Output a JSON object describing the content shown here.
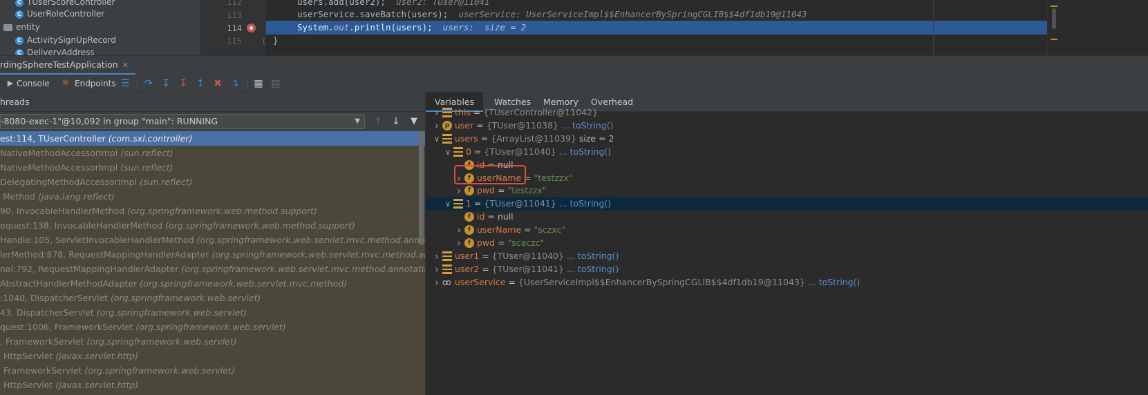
{
  "project_tree": [
    {
      "kind": "class",
      "label": "TUserScoreController"
    },
    {
      "kind": "class",
      "label": "UserRoleController"
    },
    {
      "kind": "folder",
      "label": "entity"
    },
    {
      "kind": "class",
      "label": "ActivitySignUpRecord"
    },
    {
      "kind": "class",
      "label": "DeliveryAddress"
    }
  ],
  "editor": {
    "lines": [
      {
        "no": "112",
        "code": "users.add(user2);",
        "hint": "user2: TUser@11041"
      },
      {
        "no": "113",
        "code": "userService.saveBatch(users);",
        "hint": "userService: UserServiceImpl$$EnhancerBySpringCGLIB$$4df1db19@11043"
      },
      {
        "no": "114",
        "code": "System.out.println(users);",
        "hint": "users:  size = 2"
      },
      {
        "no": "115",
        "code": "}",
        "hint": ""
      }
    ]
  },
  "debug": {
    "session_tab": "rdingSphereTestApplication",
    "toolbar": {
      "console": "Console",
      "endpoints": "Endpoints"
    },
    "frames_header": "hreads",
    "thread": "-8080-exec-1\"@10,092 in group \"main\": RUNNING",
    "frames": [
      {
        "method": "est:114, TUserController",
        "pkg": "(com.sxl.controller)"
      },
      {
        "method": "NativeMethodAccessorImpl",
        "pkg": "(sun.reflect)"
      },
      {
        "method": "NativeMethodAccessorImpl",
        "pkg": "(sun.reflect)"
      },
      {
        "method": "DelegatingMethodAccessorImpl",
        "pkg": "(sun.reflect)"
      },
      {
        "method": "Method",
        "pkg": "(java.lang.reflect)"
      },
      {
        "method": "90, InvocableHandlerMethod",
        "pkg": "(org.springframework.web.method.support)"
      },
      {
        "method": "equest:138, InvocableHandlerMethod",
        "pkg": "(org.springframework.web.method.support)"
      },
      {
        "method": "Handle:105, ServletInvocableHandlerMethod",
        "pkg": "(org.springframework.web.servlet.mvc.method.annotation)"
      },
      {
        "method": "lerMethod:878, RequestMappingHandlerAdapter",
        "pkg": "(org.springframework.web.servlet.mvc.method.annotatio"
      },
      {
        "method": "nal:792, RequestMappingHandlerAdapter",
        "pkg": "(org.springframework.web.servlet.mvc.method.annotation)"
      },
      {
        "method": "AbstractHandlerMethodAdapter",
        "pkg": "(org.springframework.web.servlet.mvc.method)"
      },
      {
        "method": ":1040, DispatcherServlet",
        "pkg": "(org.springframework.web.servlet)"
      },
      {
        "method": "43, DispatcherServlet",
        "pkg": "(org.springframework.web.servlet)"
      },
      {
        "method": "quest:1006, FrameworkServlet",
        "pkg": "(org.springframework.web.servlet)"
      },
      {
        "method": ", FrameworkServlet",
        "pkg": "(org.springframework.web.servlet)"
      },
      {
        "method": "HttpServlet",
        "pkg": "(javax.servlet.http)"
      },
      {
        "method": "FrameworkServlet",
        "pkg": "(org.springframework.web.servlet)"
      },
      {
        "method": "HttpServlet",
        "pkg": "(javax.servlet.http)"
      }
    ],
    "var_tabs": [
      "Variables",
      "Watches",
      "Memory",
      "Overhead"
    ],
    "variables": [
      {
        "depth": 0,
        "icon": "list",
        "name": "this",
        "ref": "{TUserController@11042}",
        "extra": "",
        "link": "",
        "chev": ">"
      },
      {
        "depth": 0,
        "icon": "p",
        "name": "user",
        "ref": "{TUser@11038}",
        "extra": "",
        "link": "... toString()",
        "chev": ">"
      },
      {
        "depth": 0,
        "icon": "list",
        "name": "users",
        "ref": "{ArrayList@11039}",
        "extra": "size = 2",
        "link": "",
        "chev": "v"
      },
      {
        "depth": 1,
        "icon": "list",
        "name": "0",
        "ref": "{TUser@11040}",
        "extra": "",
        "link": "... toString()",
        "chev": "v"
      },
      {
        "depth": 2,
        "icon": "f",
        "name": "id",
        "value": "null",
        "vtype": "null",
        "chev": ""
      },
      {
        "depth": 2,
        "icon": "f",
        "name": "userName",
        "value": "\"testzzx\"",
        "vtype": "str",
        "chev": ">"
      },
      {
        "depth": 2,
        "icon": "f",
        "name": "pwd",
        "value": "\"testzzx\"",
        "vtype": "str",
        "chev": ">"
      },
      {
        "depth": 1,
        "icon": "list",
        "name": "1",
        "ref": "{TUser@11041}",
        "extra": "",
        "link": "... toString()",
        "chev": "v",
        "highlight": true
      },
      {
        "depth": 2,
        "icon": "f",
        "name": "id",
        "value": "null",
        "vtype": "null",
        "chev": ""
      },
      {
        "depth": 2,
        "icon": "f",
        "name": "userName",
        "value": "\"sczxc\"",
        "vtype": "str",
        "chev": ">"
      },
      {
        "depth": 2,
        "icon": "f",
        "name": "pwd",
        "value": "\"scaczc\"",
        "vtype": "str",
        "chev": ">"
      },
      {
        "depth": 0,
        "icon": "list",
        "name": "user1",
        "ref": "{TUser@11040}",
        "extra": "",
        "link": "... toString()",
        "chev": ">"
      },
      {
        "depth": 0,
        "icon": "list",
        "name": "user2",
        "ref": "{TUser@11041}",
        "extra": "",
        "link": "... toString()",
        "chev": ">"
      },
      {
        "depth": 0,
        "icon": "glasses",
        "name": "userService",
        "ref": "{UserServiceImpl$$EnhancerBySpringCGLIB$$4df1db19@11043}",
        "extra": "",
        "link": "... toString()",
        "chev": ">"
      }
    ]
  }
}
